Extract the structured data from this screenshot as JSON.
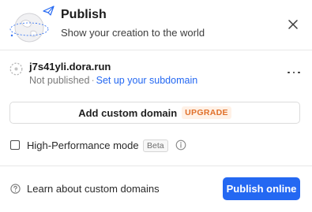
{
  "header": {
    "title": "Publish",
    "subtitle": "Show your creation to the world",
    "illustration": "globe-with-paper-plane-icon",
    "close_icon": "close-icon"
  },
  "site": {
    "url": "j7s41yli.dora.run",
    "status": "Not published",
    "separator": "·",
    "subdomain_link": "Set up your subdomain",
    "more_icon": "more-horizontal-icon",
    "site_icon": "dashed-circle-icon"
  },
  "custom_domain": {
    "button_label": "Add custom domain",
    "badge": "UPGRADE"
  },
  "high_performance": {
    "checked": false,
    "label": "High-Performance mode",
    "badge": "Beta",
    "info_icon": "info-icon"
  },
  "footer": {
    "help_icon": "help-circle-icon",
    "help_link": "Learn about custom domains",
    "publish_button": "Publish online"
  },
  "colors": {
    "accent": "#2468f2",
    "upgrade_text": "#e0702a",
    "upgrade_bg": "#fff1e6",
    "divider": "#e8e8e8"
  }
}
